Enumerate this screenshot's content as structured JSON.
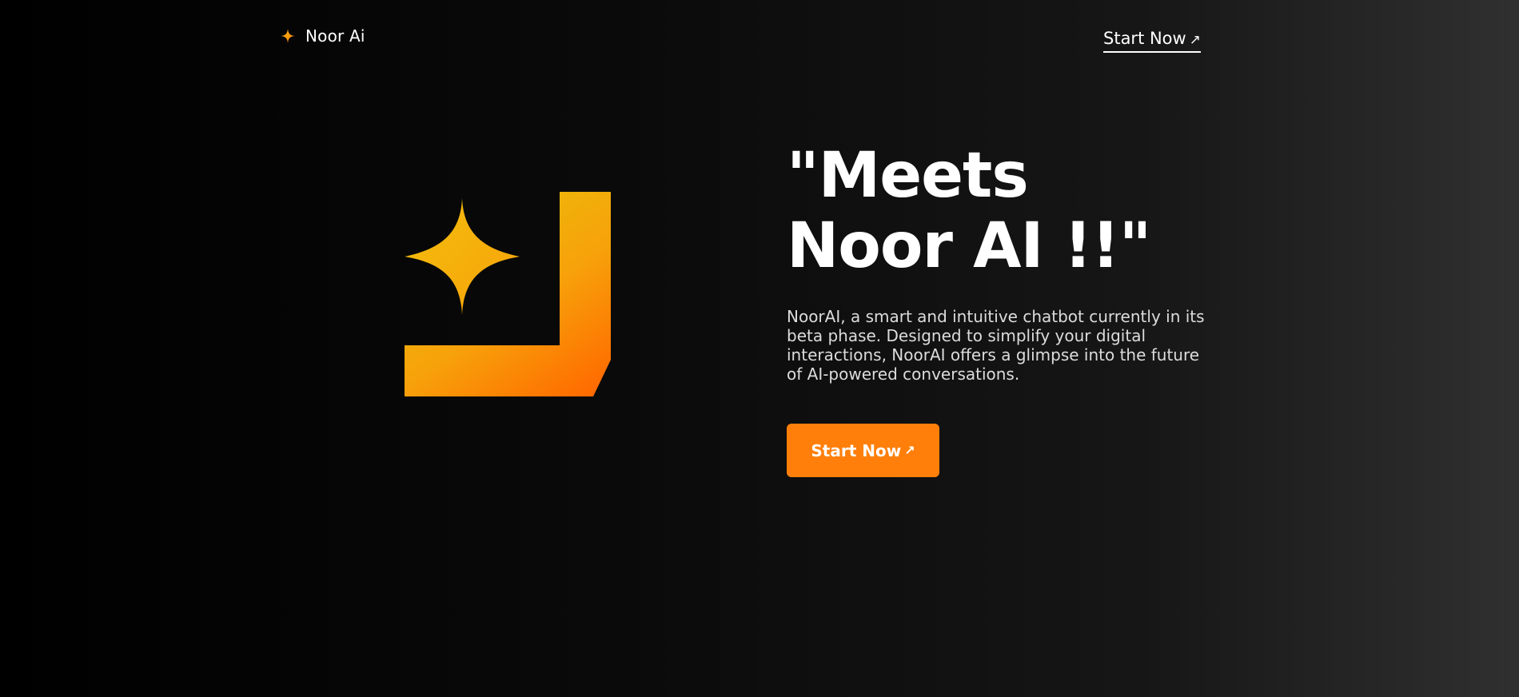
{
  "colors": {
    "accent": "#ff7f0a",
    "gradient_start": "#e9c20a",
    "gradient_end": "#ff6a00",
    "background": "#0a0a0a"
  },
  "nav": {
    "brand_icon": "sparkle-icon",
    "brand_name": "Noor Ai",
    "cta_label": "Start Now",
    "cta_arrow": "↗"
  },
  "hero": {
    "logo_icon": "sparkle-corner-logo",
    "headline_line1": "\"Meets",
    "headline_line2": "Noor AI !!\"",
    "description": "NoorAI, a smart and intuitive chatbot currently in its beta phase. Designed to simplify your digital interactions, NoorAI offers a glimpse into the future of AI-powered conversations.",
    "cta_label": "Start Now",
    "cta_arrow": "↗"
  }
}
